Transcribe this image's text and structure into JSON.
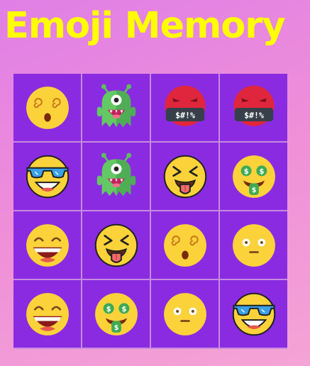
{
  "app": {
    "title": "Emoji Memory"
  },
  "colors": {
    "background": "#ee8edb",
    "card": "#8a2be2",
    "title": "#ffff00",
    "emoji_face": "#fbd23a"
  },
  "board": {
    "rows": 4,
    "columns": 4,
    "cards": [
      {
        "emoji": "dizzy-face-icon"
      },
      {
        "emoji": "alien-monster-icon"
      },
      {
        "emoji": "cursing-face-icon",
        "text": "$#!%"
      },
      {
        "emoji": "cursing-face-icon",
        "text": "$#!%"
      },
      {
        "emoji": "sunglasses-face-icon"
      },
      {
        "emoji": "alien-monster-icon"
      },
      {
        "emoji": "squinting-tongue-face-icon"
      },
      {
        "emoji": "money-mouth-face-icon"
      },
      {
        "emoji": "grinning-face-icon"
      },
      {
        "emoji": "squinting-tongue-face-icon"
      },
      {
        "emoji": "dizzy-face-icon"
      },
      {
        "emoji": "neutral-face-icon"
      },
      {
        "emoji": "grinning-face-icon"
      },
      {
        "emoji": "money-mouth-face-icon"
      },
      {
        "emoji": "neutral-face-icon"
      },
      {
        "emoji": "sunglasses-face-icon"
      }
    ]
  }
}
